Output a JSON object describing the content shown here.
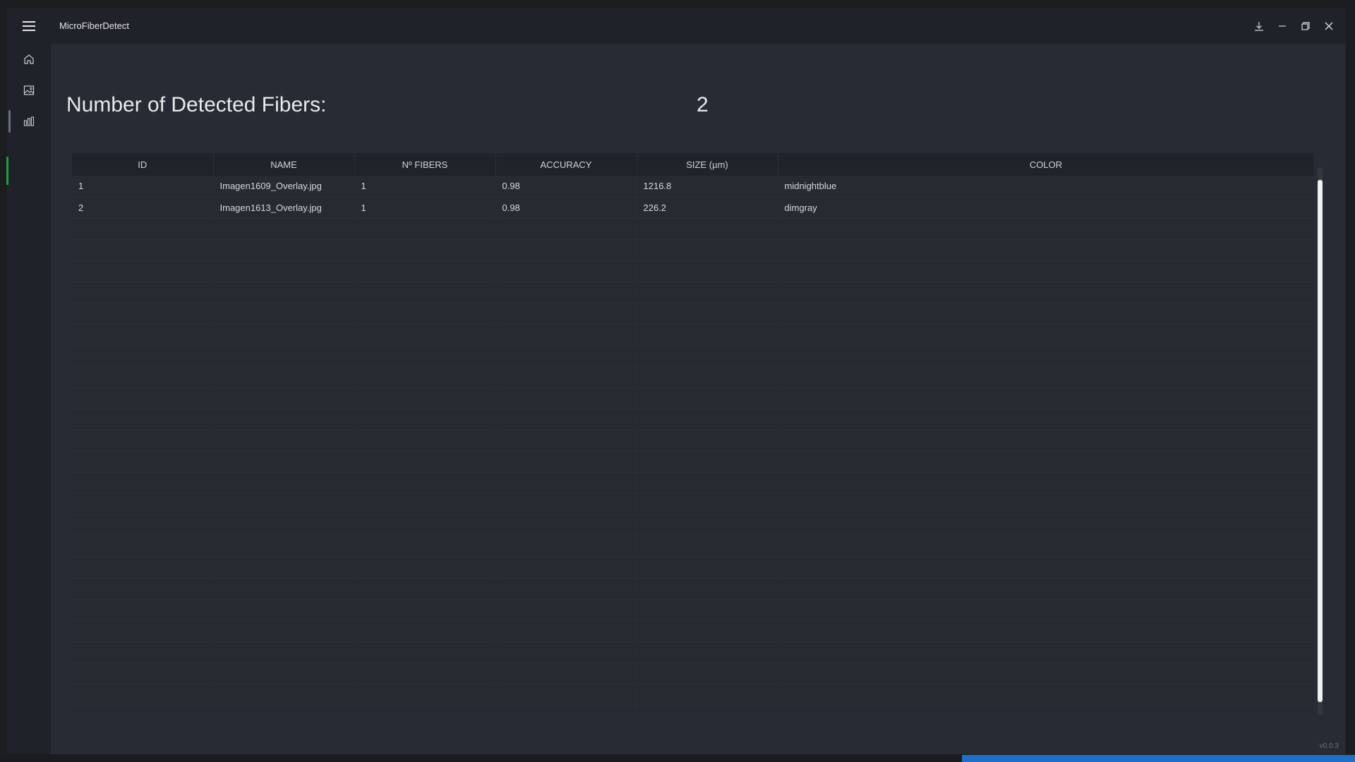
{
  "window": {
    "title": "MicroFiberDetect",
    "version": "v0.0.3"
  },
  "icons": {
    "menu": "hamburger-menu-icon",
    "download": "download-icon",
    "minimize": "minimize-icon",
    "restore": "restore-icon",
    "close": "close-icon",
    "home": "home-icon",
    "image": "image-icon",
    "chart": "bar-chart-icon"
  },
  "summary": {
    "label": "Number of Detected Fibers:",
    "count": "2"
  },
  "table": {
    "columns": [
      "ID",
      "NAME",
      "Nº FIBERS",
      "ACCURACY",
      "SIZE (µm)",
      "COLOR"
    ],
    "rows": [
      {
        "id": "1",
        "name": "Imagen1609_Overlay.jpg",
        "fibers": "1",
        "accuracy": "0.98",
        "size": "1216.8",
        "color": "midnightblue"
      },
      {
        "id": "2",
        "name": "Imagen1613_Overlay.jpg",
        "fibers": "1",
        "accuracy": "0.98",
        "size": "226.2",
        "color": "dimgray"
      }
    ]
  },
  "colors": {
    "background": "#272b33",
    "titlebar": "#1f2228",
    "accent_green": "#1e9b3c",
    "taskbar_blue": "#1f6fc6"
  }
}
